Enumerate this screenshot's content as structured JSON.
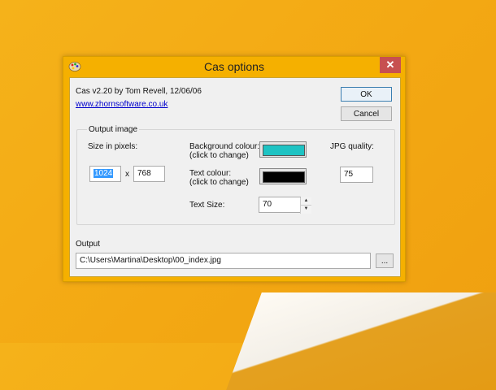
{
  "window": {
    "title": "Cas options",
    "close_glyph": "✕"
  },
  "about": {
    "version": "Cas v2.20 by Tom Revell, 12/06/06",
    "link": "www.zhornsoftware.co.uk"
  },
  "buttons": {
    "ok": "OK",
    "cancel": "Cancel",
    "browse": "..."
  },
  "output_image": {
    "label": "Output image",
    "size_label": "Size in pixels:",
    "width": "1024",
    "times": "x",
    "height": "768",
    "bg_label_1": "Background colour:",
    "bg_label_2": "(click to change)",
    "bg_color": "#1ec3c3",
    "text_label_1": "Text colour:",
    "text_label_2": "(click to change)",
    "text_color": "#000000",
    "text_size_label": "Text Size:",
    "text_size": "70",
    "jpg_label": "JPG quality:",
    "jpg_quality": "75"
  },
  "output": {
    "label": "Output",
    "path": "C:\\Users\\Martina\\Desktop\\00_index.jpg"
  }
}
